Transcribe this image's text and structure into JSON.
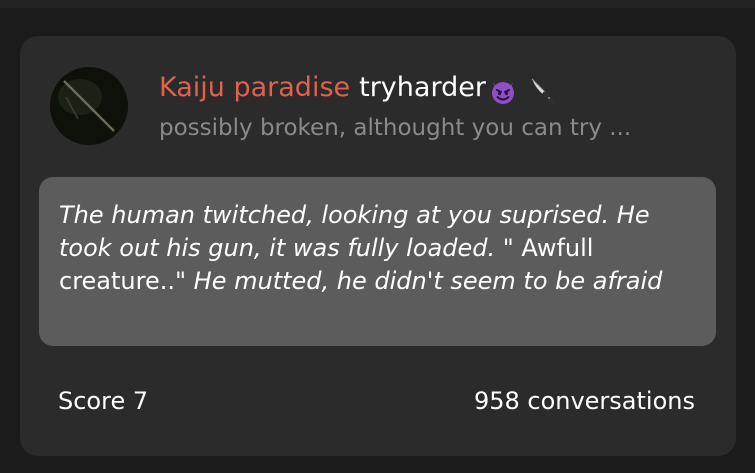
{
  "card": {
    "bot_name": "Kaiju paradise",
    "creator_name": "tryharder",
    "creator_emojis": [
      "devil-emoji",
      "knife-emoji"
    ],
    "description": "possibly broken, althought you can try ...",
    "greeting": {
      "part1_italic": "The human twitched, looking at you suprised. He took out his gun, it was fully loaded.",
      "part2_plain": " \" Awfull creature..\" ",
      "part3_italic": "He mutted, he didn't seem to be afraid"
    },
    "score_label": "Score 7",
    "conversations_label": "958 conversations"
  },
  "colors": {
    "bot_name": "#e2604c",
    "card_bg": "#2b2b2b",
    "message_bg": "#5c5c5c",
    "subtitle": "#8a8a8a"
  }
}
